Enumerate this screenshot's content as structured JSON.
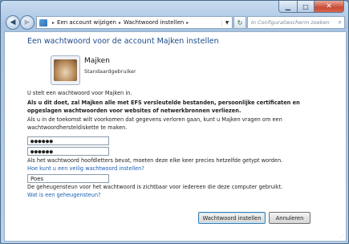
{
  "nav": {
    "breadcrumbs": [
      "Een account wijzigen",
      "Wachtwoord instellen"
    ],
    "search_placeholder": "In Configuratiescherm zoeken"
  },
  "page": {
    "title": "Een wachtwoord voor de account Majken instellen",
    "user_name": "Majken",
    "user_type": "Standaardgebruiker",
    "intro": "U stelt een wachtwoord voor Majken in.",
    "warning": "Als u dit doet, zal Majken alle met EFS versleutelde bestanden, persoonlijke certificaten en opgeslagen wachtwoorden voor websites of netwerkbronnen verliezen.",
    "reset_hint": "Als u in de toekomst wilt voorkomen dat gegevens verloren gaan, kunt u Majken vragen om een wachtwoordherstel­diskette te maken.",
    "password_value": "●●●●●●",
    "confirm_value": "●●●●●●",
    "case_hint": "Als het wachtwoord hoofdletters bevat, moeten deze elke keer precies hetzelfde getypt worden.",
    "secure_link": "Hoe kunt u een veilig wachtwoord instellen?",
    "hint_value": "Poes",
    "hint_note": "De geheugensteun voor het wachtwoord is zichtbaar voor iedereen die deze computer gebruikt.",
    "hint_link": "Wat is een geheugensteun?"
  },
  "buttons": {
    "set_password": "Wachtwoord instellen",
    "cancel": "Annuleren"
  },
  "icons": {
    "back": "back-arrow-icon",
    "forward": "forward-arrow-icon",
    "refresh": "refresh-icon",
    "search": "search-icon"
  }
}
